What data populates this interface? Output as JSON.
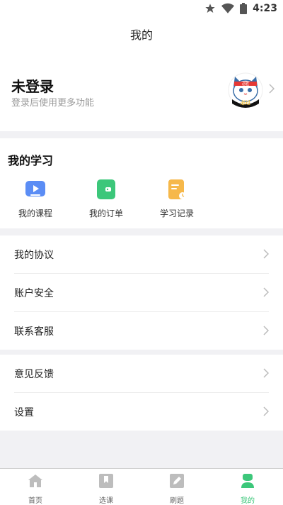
{
  "status": {
    "time": "4:23",
    "icons": [
      "star-icon",
      "wifi-icon",
      "battery-icon"
    ]
  },
  "header": {
    "title": "我的"
  },
  "profile": {
    "name": "未登录",
    "subtitle": "登录后使用更多功能",
    "avatar_text": "必过",
    "avatar_band_text": "必胜"
  },
  "study": {
    "title": "我的学习",
    "items": [
      {
        "label": "我的课程",
        "icon": "video-icon",
        "color": "#5b8df5"
      },
      {
        "label": "我的订单",
        "icon": "wallet-icon",
        "color": "#3cc77a"
      },
      {
        "label": "学习记录",
        "icon": "record-icon",
        "color": "#f6b84a"
      }
    ]
  },
  "menu_group1": [
    {
      "label": "我的协议"
    },
    {
      "label": "账户安全"
    },
    {
      "label": "联系客服"
    }
  ],
  "menu_group2": [
    {
      "label": "意见反馈"
    },
    {
      "label": "设置"
    }
  ],
  "tabbar": [
    {
      "label": "首页",
      "icon": "home-icon",
      "active": false
    },
    {
      "label": "选课",
      "icon": "bookmark-icon",
      "active": false
    },
    {
      "label": "刷题",
      "icon": "edit-icon",
      "active": false
    },
    {
      "label": "我的",
      "icon": "user-icon",
      "active": true
    }
  ],
  "colors": {
    "accent": "#3cc77a",
    "background": "#f1f1f4"
  }
}
